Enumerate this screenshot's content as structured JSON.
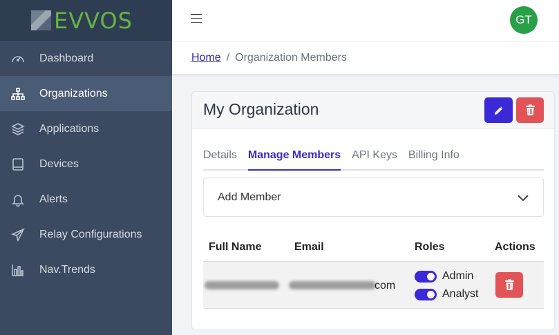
{
  "brand": {
    "name": "EVVOS",
    "logo_color": "#66b443"
  },
  "sidebar": {
    "items": [
      {
        "label": "Dashboard",
        "icon": "gauge-icon",
        "active": false
      },
      {
        "label": "Organizations",
        "icon": "sitemap-icon",
        "active": true
      },
      {
        "label": "Applications",
        "icon": "layers-icon",
        "active": false
      },
      {
        "label": "Devices",
        "icon": "tablet-icon",
        "active": false
      },
      {
        "label": "Alerts",
        "icon": "bell-icon",
        "active": false
      },
      {
        "label": "Relay Configurations",
        "icon": "paper-plane-icon",
        "active": false
      },
      {
        "label": "Nav.Trends",
        "icon": "bar-chart-icon",
        "active": false
      }
    ]
  },
  "header": {
    "avatar_initials": "GT",
    "avatar_color": "#27a047"
  },
  "breadcrumb": {
    "home": "Home",
    "separator": "/",
    "current": "Organization Members"
  },
  "card": {
    "title": "My Organization",
    "tabs": [
      {
        "label": "Details",
        "active": false
      },
      {
        "label": "Manage Members",
        "active": true
      },
      {
        "label": "API Keys",
        "active": false
      },
      {
        "label": "Billing Info",
        "active": false
      }
    ],
    "add_member_label": "Add Member"
  },
  "table": {
    "headers": {
      "name": "Full Name",
      "email": "Email",
      "roles": "Roles",
      "actions": "Actions"
    },
    "rows": [
      {
        "email_visible_tail": "com",
        "roles": [
          "Admin",
          "Analyst"
        ]
      }
    ]
  },
  "colors": {
    "primary": "#3b29d8",
    "danger": "#e25357",
    "sidebar": "#3b4a61"
  }
}
